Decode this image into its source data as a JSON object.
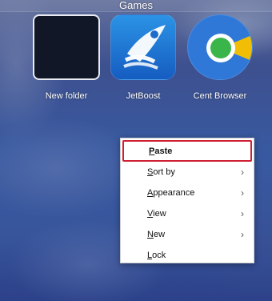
{
  "folder": {
    "title": "Games"
  },
  "apps": [
    {
      "label": "New folder",
      "icon": "folder-icon"
    },
    {
      "label": "JetBoost",
      "icon": "jetboost-icon"
    },
    {
      "label": "Cent Browser",
      "icon": "cent-browser-icon"
    }
  ],
  "context_menu": {
    "items": [
      {
        "label": "Paste",
        "shortcut_letter": "P",
        "has_submenu": false,
        "focused": true
      },
      {
        "label": "Sort by",
        "shortcut_letter": "S",
        "has_submenu": true,
        "focused": false
      },
      {
        "label": "Appearance",
        "shortcut_letter": "A",
        "has_submenu": true,
        "focused": false
      },
      {
        "label": "View",
        "shortcut_letter": "V",
        "has_submenu": true,
        "focused": false
      },
      {
        "label": "New",
        "shortcut_letter": "N",
        "has_submenu": true,
        "focused": false
      },
      {
        "label": "Lock",
        "shortcut_letter": "L",
        "has_submenu": false,
        "focused": false
      }
    ],
    "submenu_icon": "chevron-right-icon",
    "submenu_glyph": "›"
  },
  "colors": {
    "focus_border": "#cf1f34",
    "menu_bg": "#ffffff",
    "jetboost_blue": "#1d6ccb",
    "cent_blue": "#2f78d8",
    "cent_green": "#39b54a",
    "cent_yellow": "#f5c000"
  }
}
